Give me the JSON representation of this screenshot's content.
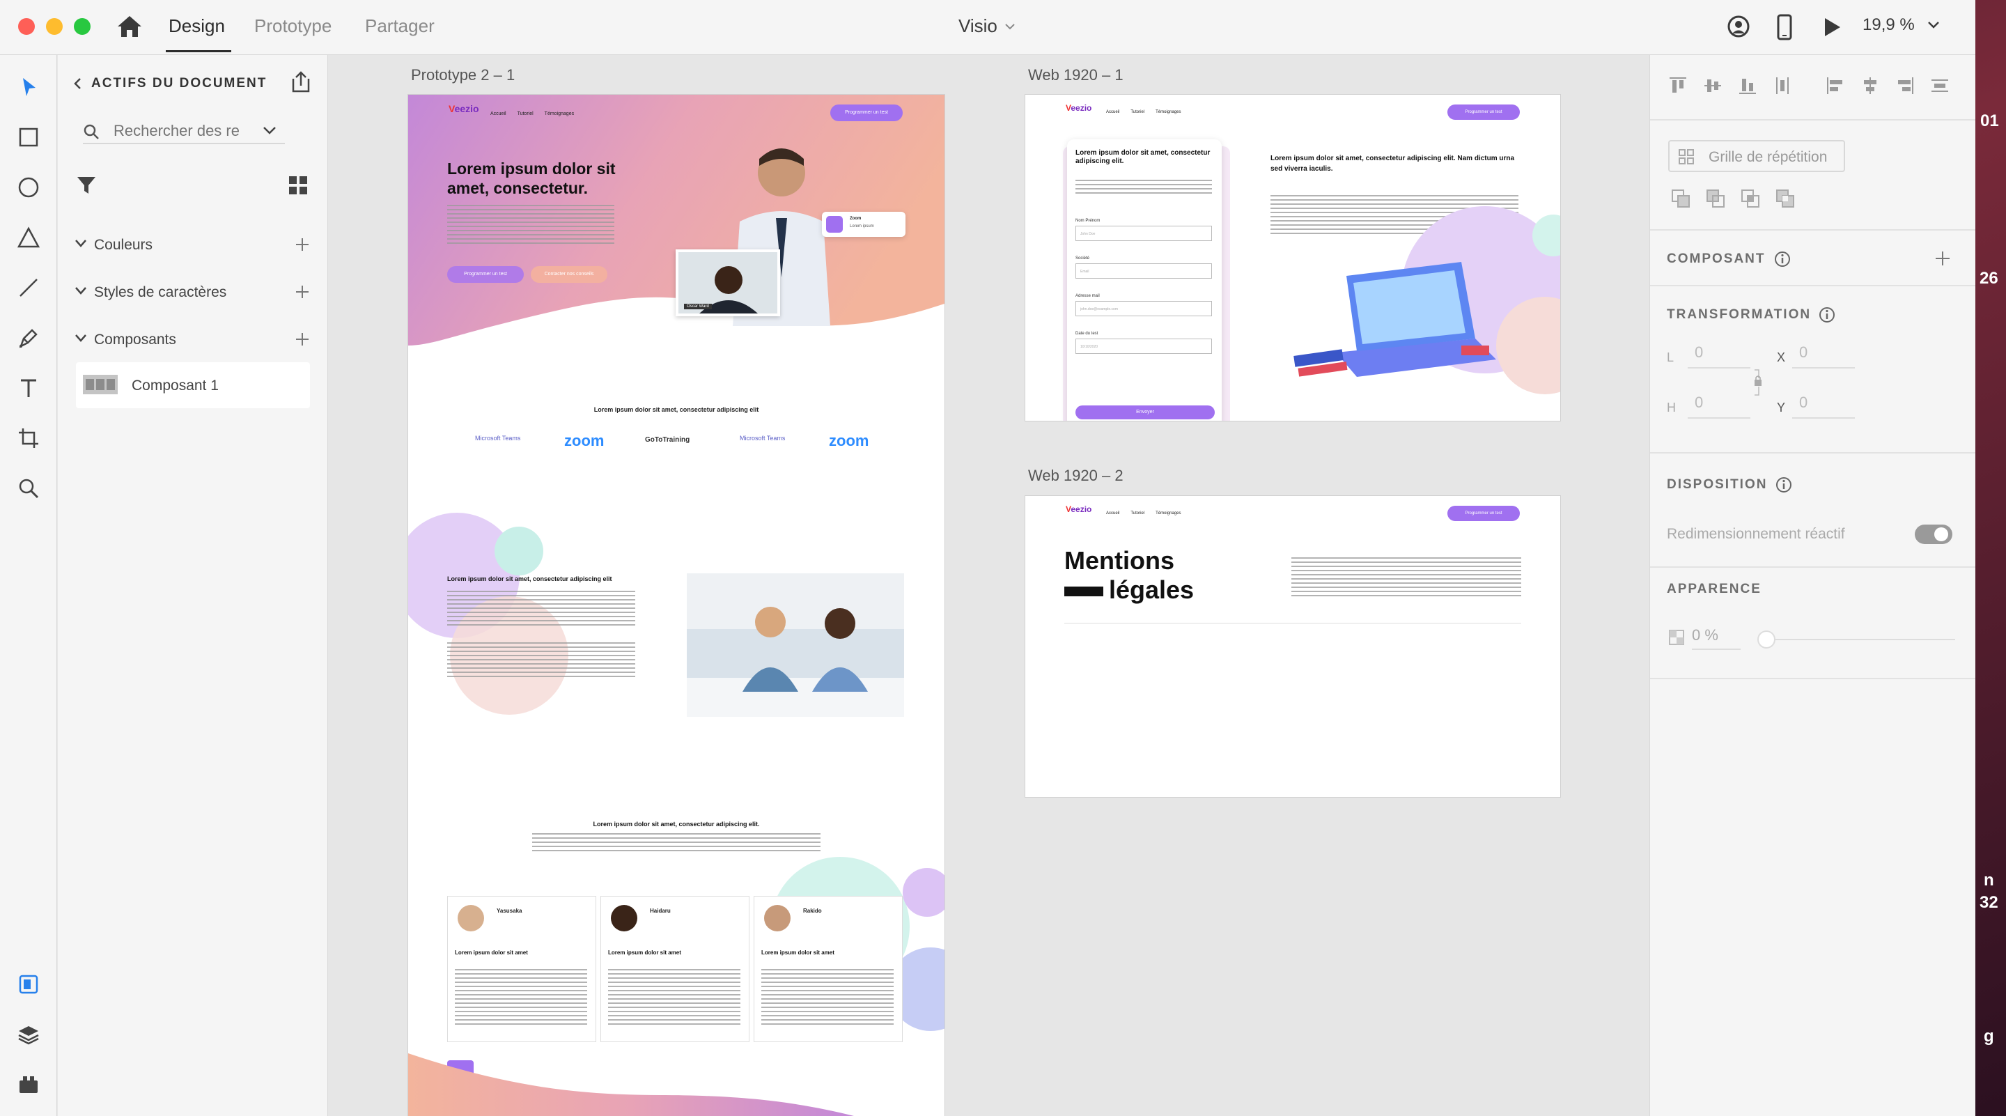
{
  "app": {
    "tabs": [
      "Design",
      "Prototype",
      "Partager"
    ],
    "doc_title": "Visio",
    "zoom": "19,9 %"
  },
  "assets": {
    "header": "ACTIFS DU DOCUMENT",
    "search_placeholder": "Rechercher des re",
    "sections": [
      "Couleurs",
      "Styles de caractères",
      "Composants"
    ],
    "component_item": "Composant 1"
  },
  "canvas": {
    "artboards": [
      "Prototype 2 – 1",
      "Web 1920 – 1",
      "Web 1920 – 2"
    ]
  },
  "proto": {
    "nav": [
      "Accueil",
      "Tutoriel",
      "Témoignages"
    ],
    "cta": "Programmer un test",
    "hero_title": "Lorem ipsum dolor sit amet, consectetur.",
    "hero_btn1": "Programmer un test",
    "hero_btn2": "Contacter nos conseils",
    "zoom_badge_title": "Zoom",
    "zoom_badge_sub": "Lorem ipsum",
    "video_name": "Oscar Ward",
    "partners_title": "Lorem ipsum dolor sit amet, consectetur adipiscing elit",
    "partners": [
      "Microsoft Teams",
      "zoom",
      "GoToTraining",
      "Microsoft Teams",
      "zoom"
    ],
    "section2_title": "Lorem ipsum dolor sit amet, consectetur adipiscing elit",
    "section3_title": "Lorem ipsum dolor sit amet, consectetur adipiscing elit.",
    "testimonials": [
      {
        "name": "Yasusaka",
        "title": "Lorem ipsum dolor sit amet"
      },
      {
        "name": "Haidaru",
        "title": "Lorem ipsum dolor sit amet"
      },
      {
        "name": "Rakido",
        "title": "Lorem ipsum dolor sit amet"
      }
    ]
  },
  "web1": {
    "form_title": "Lorem ipsum dolor sit amet, consectetur adipiscing elit.",
    "fields": [
      "Nom Prénom",
      "Société",
      "Adresse mail",
      "Date du test"
    ],
    "field_values": [
      "John Doe",
      "Email",
      "john.doe@example.com",
      "10/10/2020"
    ],
    "submit": "Envoyer",
    "right_title": "Lorem ipsum dolor sit amet, consectetur adipiscing elit. Nam dictum urna sed viverra iaculis."
  },
  "web2": {
    "title_line1": "Mentions",
    "title_line2": "légales"
  },
  "props": {
    "repeat_grid": "Grille de répétition",
    "composant": "COMPOSANT",
    "transformation": "TRANSFORMATION",
    "L": "L",
    "H": "H",
    "X": "X",
    "Y": "Y",
    "L_val": "0",
    "H_val": "0",
    "X_val": "0",
    "Y_val": "0",
    "disposition": "DISPOSITION",
    "responsive": "Redimensionnement réactif",
    "apparence": "APPARENCE",
    "opacity": "0 %"
  },
  "desktop_fragments": [
    "01",
    "26",
    "n",
    "32",
    "g"
  ],
  "colors": {
    "accent": "#a070f0",
    "canvas": "#e6e6e6",
    "select_blue": "#2680eb"
  }
}
